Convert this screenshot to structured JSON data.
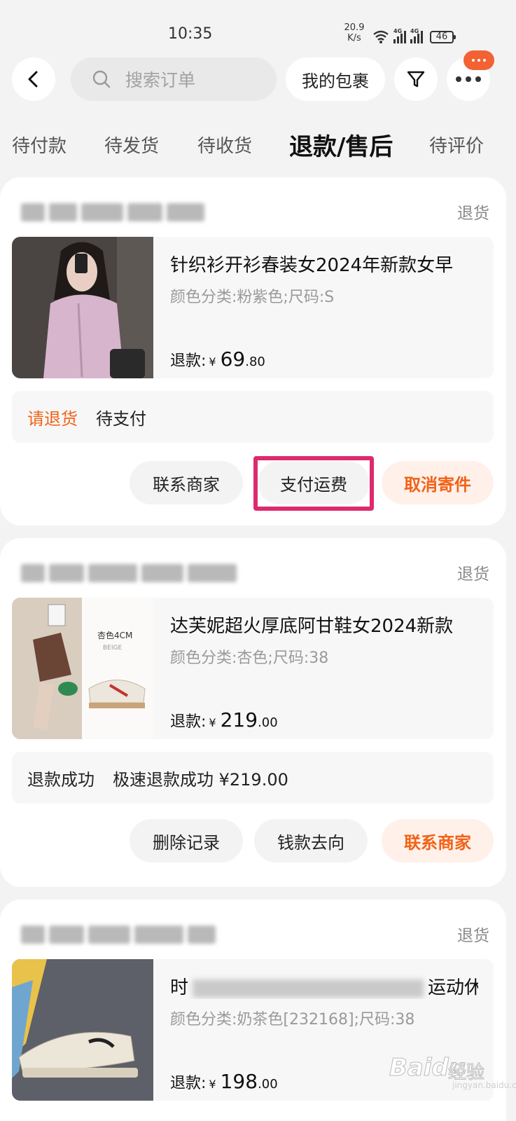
{
  "status_bar": {
    "time": "10:35",
    "net_speed_value": "20.9",
    "net_speed_unit": "K/s",
    "signal_1_label": "4G",
    "signal_2_label": "4G",
    "battery": "46"
  },
  "header": {
    "search_placeholder": "搜索订单",
    "parcel_label": "我的包裹"
  },
  "tabs": [
    {
      "label": "待付款",
      "active": false
    },
    {
      "label": "待发货",
      "active": false
    },
    {
      "label": "待收货",
      "active": false
    },
    {
      "label": "退款/售后",
      "active": true
    },
    {
      "label": "待评价",
      "active": false
    }
  ],
  "orders": [
    {
      "status": "退货",
      "title": "针织衫开衫春装女2024年新款女早",
      "spec": "颜色分类:粉紫色;尺码:S",
      "refund_label": "退款:",
      "currency": "¥",
      "price_int": "69",
      "price_dec": ".80",
      "info_primary": "请退货",
      "info_secondary": "待支付",
      "buttons": [
        "联系商家",
        "支付运费",
        "取消寄件"
      ]
    },
    {
      "status": "退货",
      "title": "达芙妮超火厚底阿甘鞋女2024新款",
      "spec": "颜色分类:杏色;尺码:38",
      "refund_label": "退款:",
      "currency": "¥",
      "price_int": "219",
      "price_dec": ".00",
      "thumb_text_1": "杏色4CM",
      "thumb_text_2": "BEIGE",
      "info_primary": "退款成功",
      "info_secondary": "极速退款成功 ¥219.00",
      "buttons": [
        "删除记录",
        "钱款去向",
        "联系商家"
      ]
    },
    {
      "status": "退货",
      "title_start": "时",
      "title_end": "运动休",
      "spec": "颜色分类:奶茶色[232168];尺码:38",
      "refund_label": "退款:",
      "currency": "¥",
      "price_int": "198",
      "price_dec": ".00"
    }
  ],
  "watermark": {
    "logo": "Baidu",
    "cn": "经验",
    "url": "jingyan.baidu.com"
  },
  "colors": {
    "accent_orange": "#f26216",
    "highlight_pink": "#dd2a6f",
    "page_bg": "#f3f3f3"
  }
}
